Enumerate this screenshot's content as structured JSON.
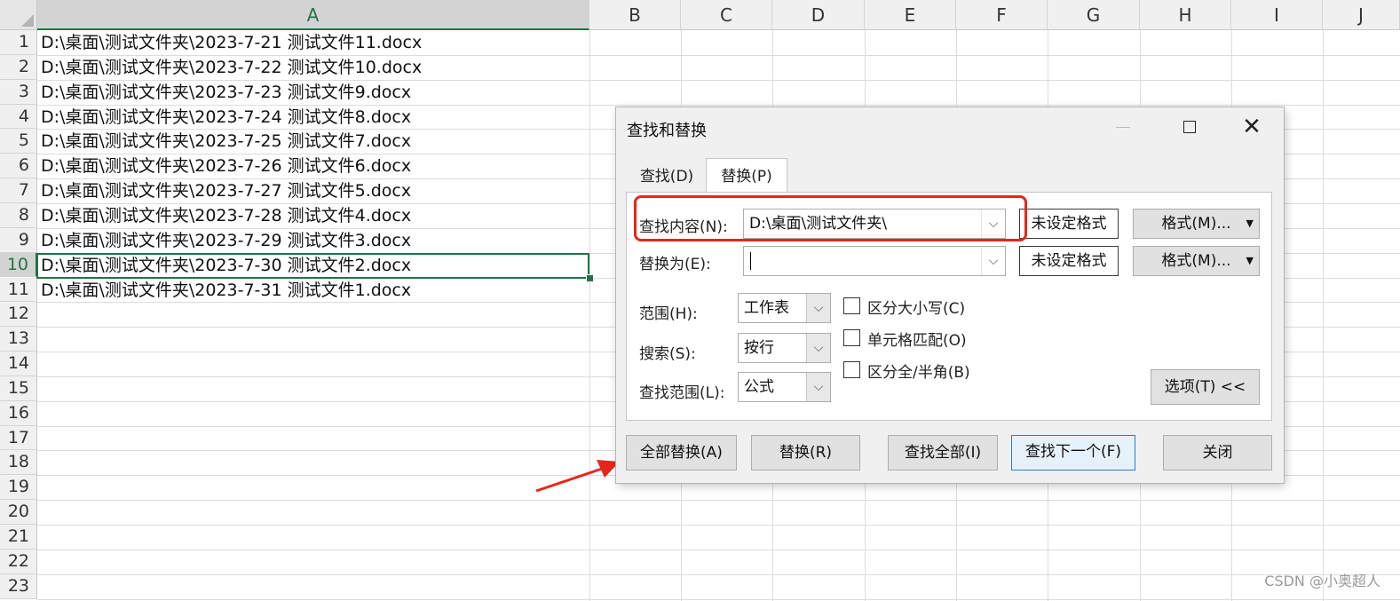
{
  "columns": [
    "A",
    "B",
    "C",
    "D",
    "E",
    "F",
    "G",
    "H",
    "I",
    "J"
  ],
  "active_column": "A",
  "rows": [
    "1",
    "2",
    "3",
    "4",
    "5",
    "6",
    "7",
    "8",
    "9",
    "10",
    "11",
    "12",
    "13",
    "14",
    "15",
    "16",
    "17",
    "18",
    "19",
    "20",
    "21",
    "22",
    "23"
  ],
  "active_row": "10",
  "cells_A": [
    "D:\\桌面\\测试文件夹\\2023-7-21 测试文件11.docx",
    "D:\\桌面\\测试文件夹\\2023-7-22 测试文件10.docx",
    "D:\\桌面\\测试文件夹\\2023-7-23 测试文件9.docx",
    "D:\\桌面\\测试文件夹\\2023-7-24 测试文件8.docx",
    "D:\\桌面\\测试文件夹\\2023-7-25 测试文件7.docx",
    "D:\\桌面\\测试文件夹\\2023-7-26 测试文件6.docx",
    "D:\\桌面\\测试文件夹\\2023-7-27 测试文件5.docx",
    "D:\\桌面\\测试文件夹\\2023-7-28 测试文件4.docx",
    "D:\\桌面\\测试文件夹\\2023-7-29 测试文件3.docx",
    "D:\\桌面\\测试文件夹\\2023-7-30 测试文件2.docx",
    "D:\\桌面\\测试文件夹\\2023-7-31 测试文件1.docx"
  ],
  "dialog": {
    "title": "查找和替换",
    "tabs": {
      "find": "查找(D)",
      "replace": "替换(P)"
    },
    "find_what": {
      "label": "查找内容(N):",
      "value": "D:\\桌面\\测试文件夹\\",
      "format_state": "未设定格式"
    },
    "replace_with": {
      "label": "替换为(E):",
      "value": "",
      "format_state": "未设定格式"
    },
    "format_button": "格式(M)...",
    "within": {
      "label": "范围(H):",
      "value": "工作表"
    },
    "search": {
      "label": "搜索(S):",
      "value": "按行"
    },
    "look_in": {
      "label": "查找范围(L):",
      "value": "公式"
    },
    "checkboxes": {
      "match_case": {
        "label": "区分大小写(C)",
        "checked": false
      },
      "match_cell": {
        "label": "单元格匹配(O)",
        "checked": false
      },
      "match_width": {
        "label": "区分全/半角(B)",
        "checked": false
      }
    },
    "options_button": "选项(T) <<",
    "buttons": {
      "replace_all": "全部替换(A)",
      "replace": "替换(R)",
      "find_all": "查找全部(I)",
      "find_next": "查找下一个(F)",
      "close": "关闭"
    }
  },
  "annotation_color": "#e8251b",
  "watermark": "CSDN @小奥超人"
}
